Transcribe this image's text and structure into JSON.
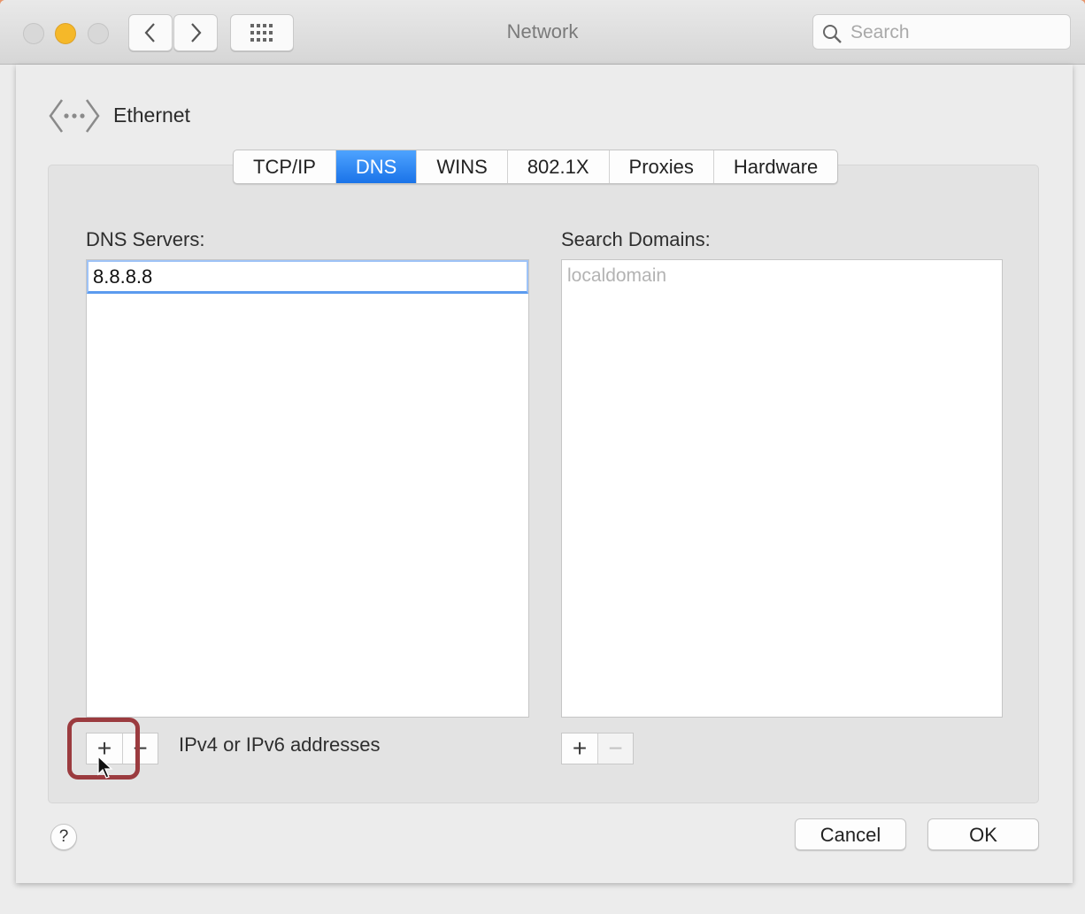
{
  "window": {
    "title": "Network",
    "search_placeholder": "Search"
  },
  "interface": {
    "name": "Ethernet",
    "icon": "ethernet-icon"
  },
  "tabs": [
    {
      "label": "TCP/IP"
    },
    {
      "label": "DNS",
      "active": true
    },
    {
      "label": "WINS"
    },
    {
      "label": "802.1X"
    },
    {
      "label": "Proxies"
    },
    {
      "label": "Hardware"
    }
  ],
  "dns": {
    "label": "DNS Servers:",
    "servers": [
      "8.8.8.8"
    ],
    "hint": "IPv4 or IPv6 addresses",
    "add": "+",
    "remove": "−"
  },
  "search_domains": {
    "label": "Search Domains:",
    "items": [
      "localdomain"
    ],
    "add": "+",
    "remove": "−"
  },
  "footer": {
    "help": "?",
    "cancel": "Cancel",
    "ok": "OK"
  },
  "colors": {
    "accent": "#1a73e8",
    "highlight_ring": "#9b3b3f",
    "minimize_light": "#f5b829"
  }
}
